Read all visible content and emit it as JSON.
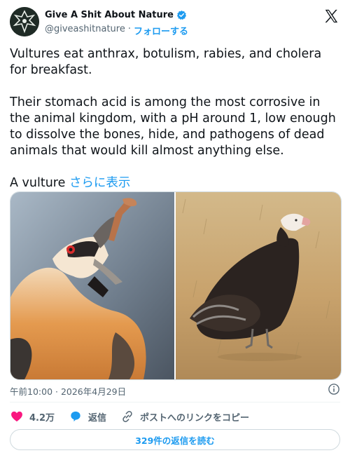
{
  "author": {
    "name": "Give A Shit About Nature",
    "handle": "@giveashitnature",
    "separator": "·",
    "follow_label": "フォローする"
  },
  "post": {
    "text_main": "Vultures eat anthrax, botulism, rabies, and cholera for breakfast.\n\nTheir stomach acid is among the most corrosive in the animal kingdom, with a pH around 1, low enough to dissolve the bones, hide, and pathogens of dead animals that would kill almost anything else.\n\nA vulture ",
    "show_more": "さらに表示"
  },
  "timestamp": "午前10:00 · 2026年4月29日",
  "actions": {
    "likes": "4.2万",
    "reply": "返信",
    "copy_link": "ポストへのリンクをコピー"
  },
  "read_replies": "329件の返信を読む",
  "colors": {
    "accent": "#1d9bf0",
    "like": "#f91880",
    "text": "#0f1419",
    "muted": "#536471"
  },
  "icons": [
    "verified-badge-icon",
    "x-logo-icon",
    "info-icon",
    "heart-icon",
    "reply-bubble-icon",
    "link-icon"
  ]
}
